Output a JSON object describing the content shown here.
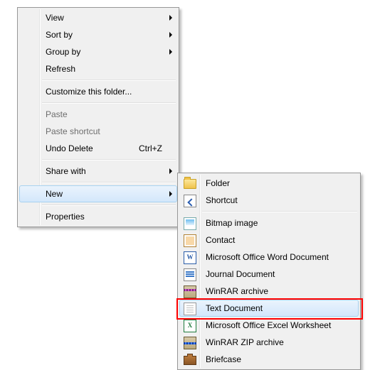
{
  "context_menu": {
    "items": [
      {
        "label": "View",
        "submenu": true
      },
      {
        "label": "Sort by",
        "submenu": true
      },
      {
        "label": "Group by",
        "submenu": true
      },
      {
        "label": "Refresh"
      }
    ],
    "items2": [
      {
        "label": "Customize this folder..."
      }
    ],
    "items3": [
      {
        "label": "Paste",
        "disabled": true
      },
      {
        "label": "Paste shortcut",
        "disabled": true
      },
      {
        "label": "Undo Delete",
        "shortcut": "Ctrl+Z"
      }
    ],
    "items4": [
      {
        "label": "Share with",
        "submenu": true
      }
    ],
    "items5": [
      {
        "label": "New",
        "submenu": true,
        "hover": true
      }
    ],
    "items6": [
      {
        "label": "Properties"
      }
    ]
  },
  "new_menu": {
    "group1": [
      {
        "label": "Folder",
        "icon": "folder"
      },
      {
        "label": "Shortcut",
        "icon": "shortcut"
      }
    ],
    "group2": [
      {
        "label": "Bitmap image",
        "icon": "bmp"
      },
      {
        "label": "Contact",
        "icon": "contact"
      },
      {
        "label": "Microsoft Office Word Document",
        "icon": "word"
      },
      {
        "label": "Journal Document",
        "icon": "journal"
      },
      {
        "label": "WinRAR archive",
        "icon": "rar"
      },
      {
        "label": "Text Document",
        "icon": "txt",
        "hover": true,
        "highlight": true
      },
      {
        "label": "Microsoft Office Excel Worksheet",
        "icon": "excel"
      },
      {
        "label": "WinRAR ZIP archive",
        "icon": "zip"
      },
      {
        "label": "Briefcase",
        "icon": "briefcase"
      }
    ]
  }
}
